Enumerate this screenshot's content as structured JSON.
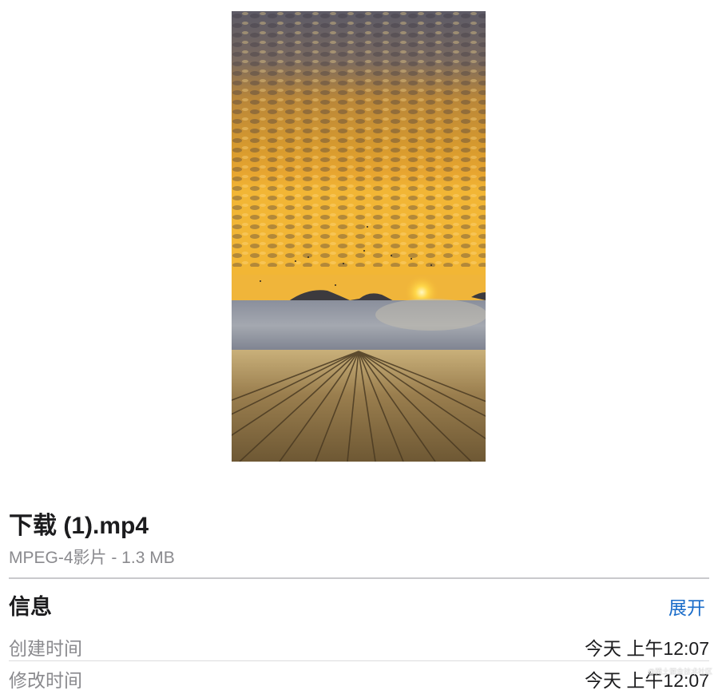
{
  "preview": {
    "description_icon": "video-thumbnail"
  },
  "file": {
    "name": "下载 (1).mp4",
    "subtitle": "MPEG-4影片 - 1.3 MB"
  },
  "info": {
    "title": "信息",
    "expand_label": "展开",
    "rows": [
      {
        "label": "创建时间",
        "value": "今天 上午12:07"
      },
      {
        "label": "修改时间",
        "value": "今天 上午12:07"
      }
    ]
  },
  "watermark": "@稀土掘金技术社区",
  "colors": {
    "accent": "#1a6cc9",
    "secondary_text": "#8a8a8e"
  }
}
